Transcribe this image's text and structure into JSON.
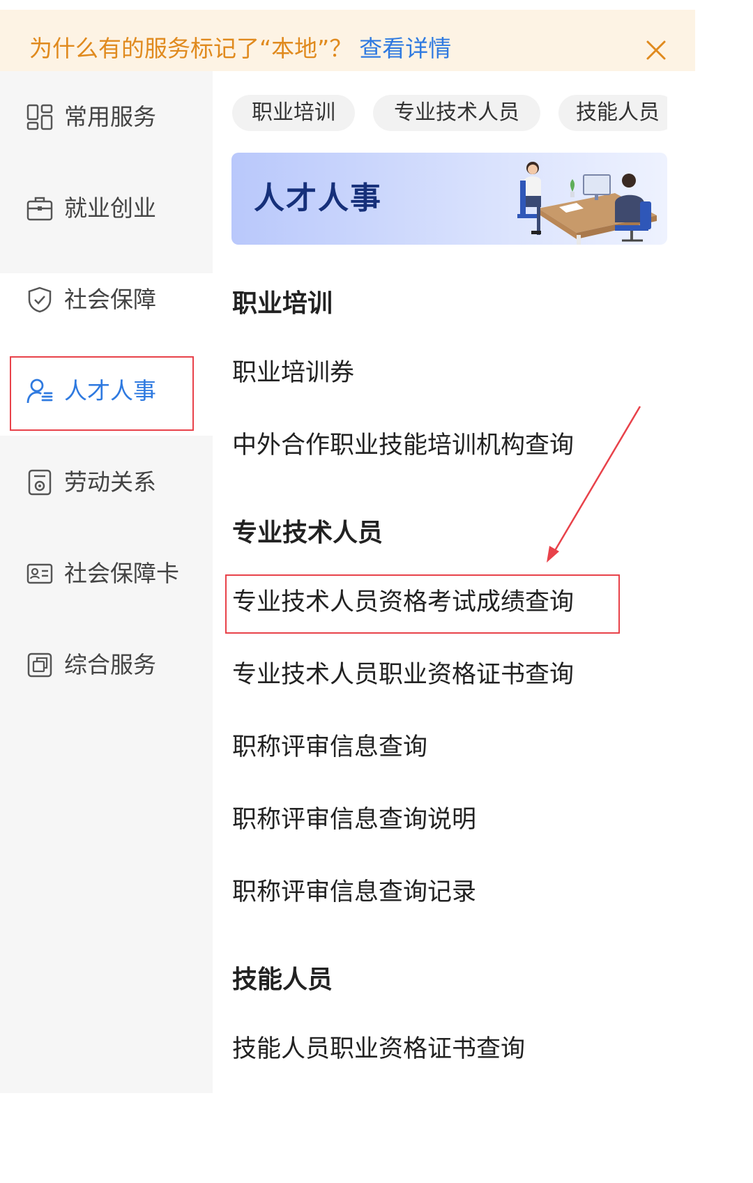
{
  "notice": {
    "text": "为什么有的服务标记了“本地”？",
    "link": "查看详情",
    "close_icon": "close-icon"
  },
  "sidebar": {
    "items": [
      {
        "label": "常用服务",
        "icon": "grid-icon"
      },
      {
        "label": "就业创业",
        "icon": "briefcase-icon"
      },
      {
        "label": "社会保障",
        "icon": "shield-check-icon"
      },
      {
        "label": "人才人事",
        "icon": "user-list-icon",
        "active": true
      },
      {
        "label": "劳动关系",
        "icon": "document-seal-icon"
      },
      {
        "label": "社会保障卡",
        "icon": "id-card-icon"
      },
      {
        "label": "综合服务",
        "icon": "copy-icon"
      }
    ]
  },
  "chips": [
    "职业培训",
    "专业技术人员",
    "技能人员"
  ],
  "banner": {
    "title": "人才人事"
  },
  "sections": [
    {
      "title": "职业培训",
      "items": [
        "职业培训券",
        "中外合作职业技能培训机构查询"
      ]
    },
    {
      "title": "专业技术人员",
      "items": [
        "专业技术人员资格考试成绩查询",
        "专业技术人员职业资格证书查询",
        "职称评审信息查询",
        "职称评审信息查询说明",
        "职称评审信息查询记录"
      ]
    },
    {
      "title": "技能人员",
      "items": [
        "技能人员职业资格证书查询"
      ]
    }
  ],
  "colors": {
    "accent": "#2f7ae0",
    "notice_text": "#e08a1e",
    "notice_bg": "#fdf3e4",
    "annotation": "#e8424a"
  }
}
